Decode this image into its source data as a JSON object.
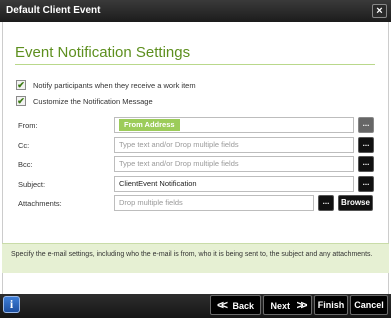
{
  "window": {
    "title": "Default Client Event",
    "close_glyph": "×"
  },
  "heading": "Event Notification Settings",
  "checks": [
    {
      "label": "Notify participants when they receive a work item",
      "checked": true
    },
    {
      "label": "Customize the Notification Message",
      "checked": true
    }
  ],
  "check_glyph": "✔",
  "fields": {
    "from": {
      "label": "From:",
      "tag": "From Address"
    },
    "cc": {
      "label": "Cc:",
      "placeholder": "Type text and/or Drop multiple fields"
    },
    "bcc": {
      "label": "Bcc:",
      "placeholder": "Type text and/or Drop multiple fields"
    },
    "subject": {
      "label": "Subject:",
      "value": "ClientEvent Notification"
    },
    "attachments": {
      "label": "Attachments:",
      "placeholder": "Drop multiple fields"
    }
  },
  "ellipsis_label": "...",
  "browse_label": "Browse",
  "info_text": "Specify the e-mail settings, including who the e-mail is from, who it is being sent to, the subject and any attachments.",
  "footer": {
    "info_glyph": "i",
    "back_label": "Back",
    "next_label": "Next",
    "finish_label": "Finish",
    "cancel_label": "Cancel",
    "back_chevrons": "<<",
    "next_chevrons": ">>"
  }
}
